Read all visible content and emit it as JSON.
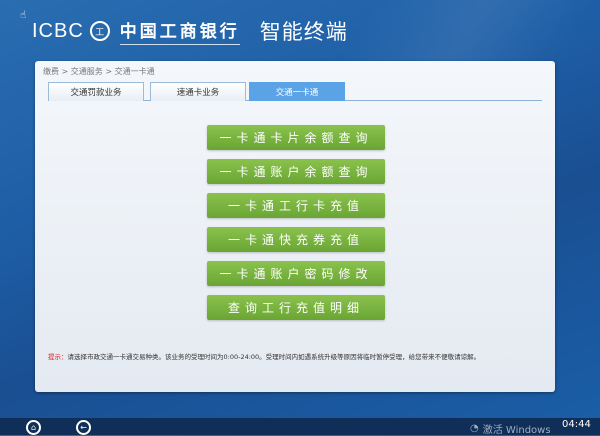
{
  "header": {
    "brand": "ICBC",
    "seal": "工",
    "bank_name": "中国工商银行",
    "terminal": "智能终端"
  },
  "breadcrumb": "缴费 > 交通服务 > 交通一卡通",
  "tabs": [
    {
      "label": "交通罚款业务"
    },
    {
      "label": "速通卡业务"
    },
    {
      "label": "交通一卡通",
      "active": true
    }
  ],
  "buttons": [
    "一卡通卡片余额查询",
    "一卡通账户余额查询",
    "一卡通工行卡充值",
    "一卡通快充券充值",
    "一卡通账户密码修改",
    "查询工行充值明细"
  ],
  "note": {
    "label": "提示：",
    "text": "请选择市政交通一卡通交易种类。该业务的受理时间为0:00-24:00。受理时间内如遇系统升级等原因将临时暂停受理，给您带来不便敬请谅解。"
  },
  "taskbar": {
    "activate": "激活 Windows",
    "clock": "04:44"
  },
  "colors": {
    "accent_green": "#78b33f",
    "tab_active": "#5aa3e6",
    "note_label": "#e02020"
  }
}
